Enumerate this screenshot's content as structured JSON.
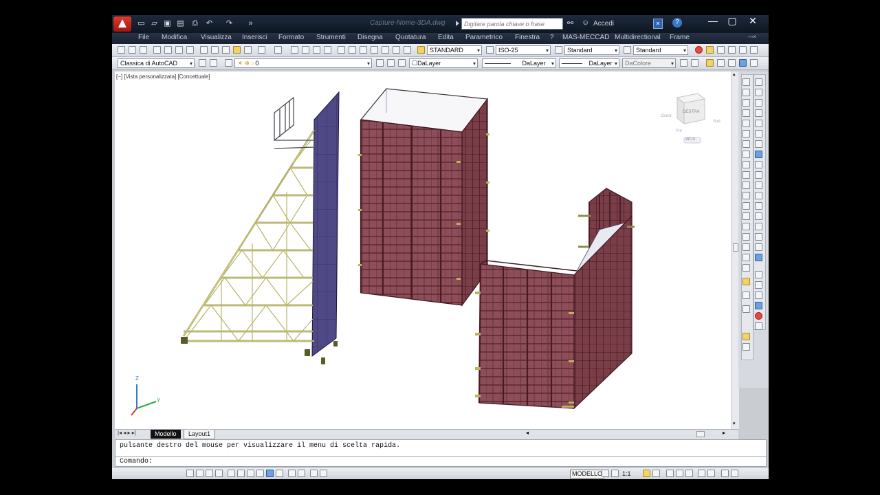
{
  "window": {
    "title": "Capture-Nome-3DA.dwg",
    "search_placeholder": "Digitare parola chiave o frase",
    "login_label": "Accedi",
    "help_label": "?",
    "minimize": "—",
    "maximize": "▢",
    "close": "✕"
  },
  "menu": {
    "items": [
      "File",
      "Modifica",
      "Visualizza",
      "Inserisci",
      "Formato",
      "Strumenti",
      "Disegna",
      "Quotatura",
      "Edita",
      "Parametrico",
      "Finestra",
      "?",
      "MAS-MECCAD",
      "Multidirectional",
      "Frame"
    ]
  },
  "toolbar_styles": {
    "text_style": "STANDARD",
    "dim_style": "ISO-25",
    "table_style": "Standard",
    "mleader_style": "Standard"
  },
  "toolbar_layers": {
    "workspace": "Classica di AutoCAD",
    "layer": "0",
    "color": "DaLayer",
    "linetype": "DaLayer",
    "lineweight": "DaLayer",
    "plotstyle": "DaColore"
  },
  "viewport": {
    "label": "[−] [Vista personalizzata] [Concettuale]",
    "viewcube_face": "DESTRA",
    "viewcube_left": "Ovest",
    "viewcube_right": "Sud",
    "viewcube_bottom": "Pnl",
    "wcs_label": "WCS",
    "ucs_z": "Z",
    "ucs_y": "Y"
  },
  "tabs": {
    "model": "Modello",
    "layout": "Layout1"
  },
  "command": {
    "history": "pulsante destro del mouse per visualizzare il menu di scelta rapida.",
    "prompt": "Comando:"
  },
  "status": {
    "model": "MODELLO",
    "scale": "1:1"
  },
  "colors": {
    "formwork_panel": "#8c4e58",
    "formwork_frame": "#5e2630",
    "scaffold": "#d9d67e",
    "scaffold_line": "#6d6a2c",
    "wall_panel": "#4f4a86"
  }
}
